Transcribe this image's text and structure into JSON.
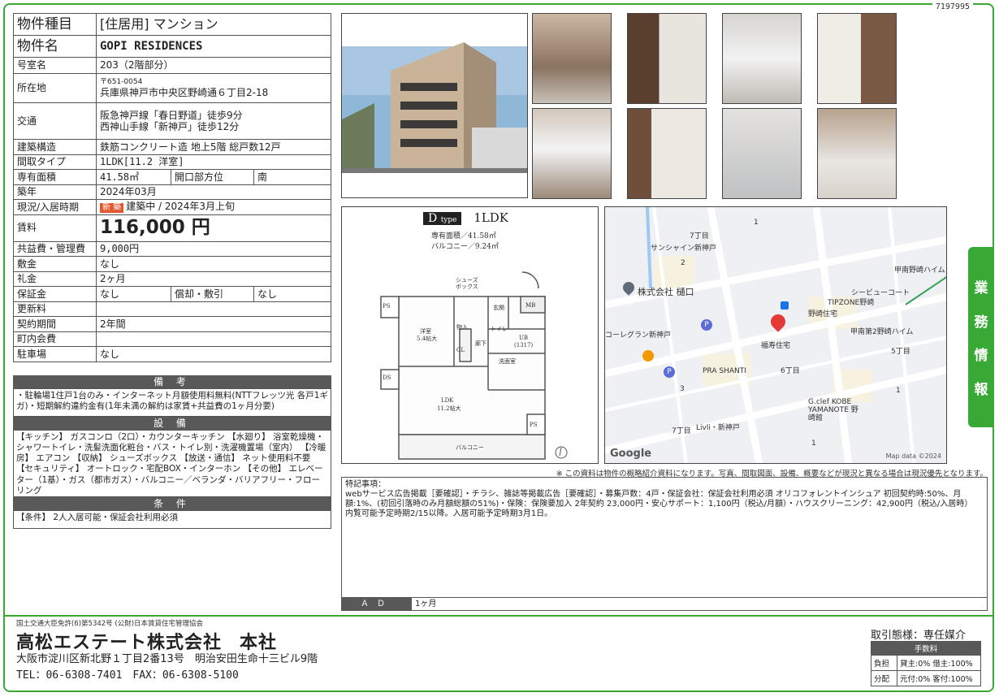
{
  "doc_id": "7197995",
  "property": {
    "type_label": "物件種目",
    "type_value": "[住居用] マンション",
    "name_label": "物件名",
    "name_value": "GOPI RESIDENCES",
    "room_label": "号室名",
    "room_value": "203（2階部分）",
    "location_label": "所在地",
    "postal": "〒651-0054",
    "address": "兵庫県神戸市中央区野崎通６丁目2-18",
    "transport_label": "交通",
    "transport_1": "阪急神戸線「春日野道」徒歩9分",
    "transport_2": "西神山手線「新神戸」徒歩12分",
    "structure_label": "建築構造",
    "structure_value": "鉄筋コンクリート造 地上5階 総戸数12戸",
    "layout_label": "間取タイプ",
    "layout_value": "1LDK[11.2 洋室]",
    "area_label": "専有面積",
    "area_value": "41.58㎡",
    "direction_label": "開口部方位",
    "direction_value": "南",
    "built_label": "築年",
    "built_value": "2024年03月",
    "status_label": "現況/入居時期",
    "status_badge": "新 築",
    "status_value": "建築中 / 2024年3月上旬",
    "rent_label": "賃料",
    "rent_value": "116,000 円",
    "fee_label": "共益費・管理費",
    "fee_value": "9,000円",
    "deposit_label": "敷金",
    "deposit_value": "なし",
    "key_label": "礼金",
    "key_value": "2ヶ月",
    "guarantee_label": "保証金",
    "guarantee_value": "なし",
    "amort_label": "償却・敷引",
    "amort_value": "なし",
    "renewal_label": "更新料",
    "renewal_value": "",
    "contract_label": "契約期間",
    "contract_value": "2年間",
    "community_label": "町内会費",
    "community_value": "",
    "parking_label": "駐車場",
    "parking_value": "なし"
  },
  "remarks": {
    "title": "備 考",
    "text": "・駐輪場1住戸1台のみ・インターネット月額使用料無料(NTTフレッツ光 各戸1ギガ)・短期解約違約金有(1年未満の解約は家賃+共益費の1ヶ月分要)"
  },
  "equipment": {
    "title": "設 備",
    "text": "【キッチン】 ガスコンロ（2口）・カウンターキッチン 【水廻り】 浴室乾燥機・シャワートイレ・洗髪洗面化粧台・バス・トイレ別・洗濯機置場（室内） 【冷暖房】 エアコン 【収納】 シューズボックス 【放送・通信】 ネット使用料不要 【セキュリティ】 オートロック・宅配BOX・インターホン 【その他】 エレベーター（1基）・ガス（都市ガス）・バルコニー／ベランダ・バリアフリー・フローリング"
  },
  "conditions": {
    "title": "条 件",
    "text": "【条件】 2人入居可能・保証会社利用必須"
  },
  "floorplan": {
    "title_type": "D",
    "title_sub": "type",
    "title_layout": "1LDK",
    "area": "専有面積／41.58㎡",
    "balcony": "バルコニー／9.24㎡",
    "rooms": [
      "洋室\n5.4帖大",
      "LDK\n11.2帖大",
      "UB\n(1317)",
      "トイレ",
      "物入",
      "CL",
      "廊下",
      "洗面室",
      "玄関",
      "MB",
      "PS",
      "DS",
      "PS",
      "バルコニー",
      "シューズボックス"
    ]
  },
  "map": {
    "labels": [
      "7丁目",
      "1",
      "サンシャイン新神戸",
      "2",
      "株式会社 樋口",
      "甲南野崎ハイム",
      "TIPZONE野崎",
      "シービューコート",
      "野崎住宅",
      "コーレグラン新神戸",
      "福寿住宅",
      "甲南第2野崎ハイム",
      "5丁目",
      "PRA SHANTI",
      "6丁目",
      "3",
      "1",
      "G.clef KOBE YAMANOTE 野崎館",
      "7丁目",
      "Livli・新神戸",
      "1"
    ],
    "google": "Google",
    "credit": "Map data ©2024"
  },
  "side_tab": [
    "業",
    "務",
    "情",
    "報"
  ],
  "caution": "※ この資料は物件の概略紹介資料になります。写真、間取図面、設備、概要などが現況と異なる場合は現況優先となります。",
  "notes": {
    "title": "特記事項：",
    "line1": "webサービス広告掲載［要確認］・チラシ、雑誌等掲載広告［要確認］・募集戸数：4戸・保証会社：保証会社利用必須 オリコフォレントインシュア 初回契約時:50%、月額:1%、(初回引落時のみ月額総額の51%)・保険：保険要加入 2年契約 23,000円・安心サポート：1,100円（税込/月額）・ハウスクリーニング：42,900円（税込/入居時）",
    "line2": "内覧可能予定時期2/15以降。入居可能予定時期3月1日。"
  },
  "ad": {
    "label": "ＡＤ",
    "value": "1ヶ月"
  },
  "footer": {
    "license": "国土交通大臣免許(6)第5342号 (公財)日本賃貸住宅管理協会",
    "company": "高松エステート株式会社",
    "branch": "本社",
    "address": "大阪市淀川区新北野１丁目2番13号　明治安田生命十三ビル9階",
    "tel": "TEL：06-6308-7401　FAX：06-6308-5100",
    "transaction": "取引態様：専任媒介",
    "fee_head": "手数料",
    "burden_label": "負担",
    "burden_value": "貸主:0% 借主:100%",
    "split_label": "分配",
    "split_value": "元付:0% 客付:100%"
  }
}
